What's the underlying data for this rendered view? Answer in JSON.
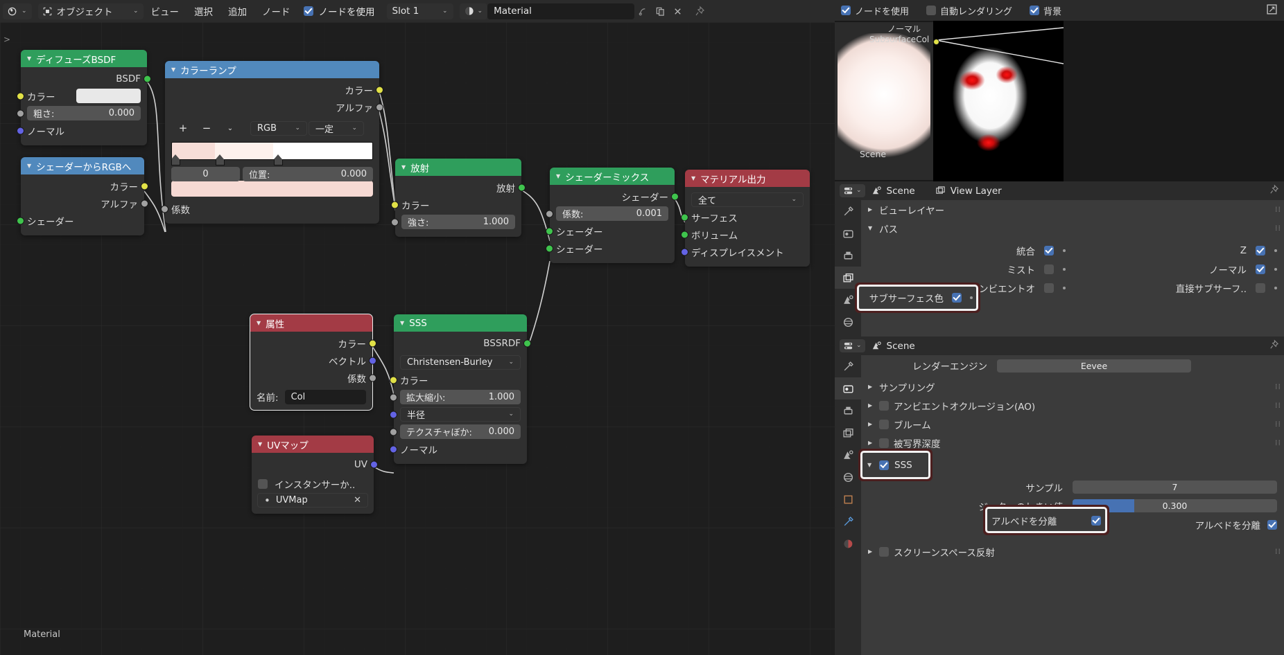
{
  "topbar": {
    "editor_type_icon": "shader-editor-icon",
    "shading_type": "オブジェクト",
    "menus": [
      "ビュー",
      "選択",
      "追加",
      "ノード"
    ],
    "use_nodes_label": "ノードを使用",
    "use_nodes_checked": true,
    "slot": "Slot 1",
    "material_icon": "material-sphere-icon",
    "material_name": "Material",
    "icons": [
      "browse-material-icon",
      "duplicate-icon",
      "unlink-icon",
      "pin-icon"
    ],
    "right_icons": [
      "overlay-icon",
      "snap-icon"
    ]
  },
  "canvas": {
    "footer_label": "Material",
    "sidebar_arrow": ">"
  },
  "nodes": [
    {
      "id": "diffuse-bsdf",
      "title": "ディフューズBSDF",
      "header_color": "#2f9e5c",
      "outputs": [
        {
          "label": "BSDF",
          "color": "green"
        }
      ],
      "inputs": [
        {
          "label": "カラー",
          "color": "yellow",
          "widget": "swatch",
          "value": "#e8e8e8"
        },
        {
          "label": "粗さ:",
          "color": "grey",
          "widget": "field",
          "value": "0.000"
        },
        {
          "label": "ノーマル",
          "color": "purple",
          "widget": "none"
        }
      ]
    },
    {
      "id": "shader-to-rgb",
      "title": "シェーダーからRGBへ",
      "header_color": "#5189bd",
      "outputs": [
        {
          "label": "カラー",
          "color": "yellow"
        },
        {
          "label": "アルファ",
          "color": "grey"
        }
      ],
      "inputs": [
        {
          "label": "シェーダー",
          "color": "green"
        }
      ]
    },
    {
      "id": "color-ramp",
      "title": "カラーランプ",
      "header_color": "#5189bd",
      "outputs": [
        {
          "label": "カラー",
          "color": "yellow"
        },
        {
          "label": "アルファ",
          "color": "grey"
        }
      ],
      "inputs": [
        {
          "label": "係数",
          "color": "grey"
        }
      ],
      "ramp": {
        "buttons": [
          "+",
          "−",
          "⌄"
        ],
        "color_mode": "RGB",
        "interpolation": "一定",
        "index": "0",
        "position_label": "位置:",
        "position_value": "0.000",
        "active_color": "#f6d9d3",
        "stops": [
          {
            "pos": 0.0,
            "color": "#f7ddd7"
          },
          {
            "pos": 0.215,
            "color": "#fdf1ec"
          },
          {
            "pos": 0.505,
            "color": "#ffffff"
          }
        ]
      }
    },
    {
      "id": "emission",
      "title": "放射",
      "header_color": "#2f9e5c",
      "outputs": [
        {
          "label": "放射",
          "color": "green"
        }
      ],
      "inputs": [
        {
          "label": "カラー",
          "color": "yellow",
          "widget": "none"
        },
        {
          "label": "強さ:",
          "color": "grey",
          "widget": "field",
          "value": "1.000"
        }
      ]
    },
    {
      "id": "mix-shader",
      "title": "シェーダーミックス",
      "header_color": "#2f9e5c",
      "outputs": [
        {
          "label": "シェーダー",
          "color": "green"
        }
      ],
      "inputs": [
        {
          "label": "係数:",
          "color": "grey",
          "widget": "field",
          "value": "0.001"
        },
        {
          "label": "シェーダー",
          "color": "green",
          "widget": "none"
        },
        {
          "label": "シェーダー",
          "color": "green",
          "widget": "none"
        }
      ]
    },
    {
      "id": "material-output",
      "title": "マテリアル出力",
      "header_color": "#a33b45",
      "target": "全て",
      "inputs": [
        {
          "label": "サーフェス",
          "color": "green"
        },
        {
          "label": "ボリューム",
          "color": "green"
        },
        {
          "label": "ディスプレイスメント",
          "color": "purple"
        }
      ]
    },
    {
      "id": "attribute",
      "title": "属性",
      "header_color": "#a33b45",
      "selected": true,
      "outputs": [
        {
          "label": "カラー",
          "color": "yellow"
        },
        {
          "label": "ベクトル",
          "color": "purple"
        },
        {
          "label": "係数",
          "color": "grey"
        }
      ],
      "name_label": "名前:",
      "name_value": "Col"
    },
    {
      "id": "sss",
      "title": "SSS",
      "header_color": "#2f9e5c",
      "outputs": [
        {
          "label": "BSSRDF",
          "color": "green"
        }
      ],
      "method": "Christensen-Burley",
      "inputs": [
        {
          "label": "カラー",
          "color": "yellow",
          "widget": "none"
        },
        {
          "label": "拡大縮小:",
          "color": "grey",
          "widget": "field",
          "value": "1.000"
        },
        {
          "label": "半径",
          "color": "purple",
          "widget": "drop",
          "value": "半径"
        },
        {
          "label": "テクスチャぼか:",
          "color": "grey",
          "widget": "field",
          "value": "0.000"
        },
        {
          "label": "ノーマル",
          "color": "purple",
          "widget": "none"
        }
      ]
    },
    {
      "id": "uv-map",
      "title": "UVマップ",
      "header_color": "#a33b45",
      "outputs": [
        {
          "label": "UV",
          "color": "purple"
        }
      ],
      "from_instancer_label": "インスタンサーか..",
      "from_instancer_checked": false,
      "uvmap_value": "UVMap"
    }
  ],
  "preview_header": {
    "use_nodes_label": "ノードを使用",
    "use_nodes_checked": true,
    "auto_render_label": "自動レンダリング",
    "auto_render_checked": false,
    "backdrop_label": "背景",
    "backdrop_checked": true,
    "maximize_icon": "maximize-icon"
  },
  "preview": {
    "socket_labels": [
      "ノーマル",
      "SubsurfaceCol"
    ],
    "scene_label": "Scene"
  },
  "viewlayer_panel": {
    "editor_icon": "properties-editor-icon",
    "scene_name": "Scene",
    "viewlayer_name": "View Layer",
    "pin_icon": "pin-icon",
    "tabs": [
      "tool-icon",
      "render-icon",
      "output-icon",
      "viewlayer-icon",
      "scene-icon",
      "world-icon"
    ],
    "active_tab_index": 3,
    "sections": [
      {
        "label": "ビューレイヤー",
        "open": false
      },
      {
        "label": "パス",
        "open": true
      }
    ],
    "passes": [
      {
        "left_label": "統合",
        "left_checked": true,
        "right_label": "Z",
        "right_checked": true
      },
      {
        "left_label": "ミスト",
        "left_checked": false,
        "right_label": "ノーマル",
        "right_checked": true
      },
      {
        "left_label": "アンビエントオ",
        "left_checked": false,
        "right_label": "直接サブサーフ..",
        "right_checked": false
      },
      {
        "left_label": "サブサーフェス色",
        "left_checked": true,
        "right_label": "",
        "right_checked": false,
        "highlight": true
      }
    ]
  },
  "render_panel": {
    "editor_icon": "properties-editor-icon",
    "scene_name": "Scene",
    "pin_icon": "pin-icon",
    "engine_label": "レンダーエンジン",
    "engine_value": "Eevee",
    "tabs": [
      "tool-icon",
      "render-icon",
      "output-icon",
      "viewlayer-icon",
      "scene-icon",
      "world-icon",
      "object-icon",
      "modifier-icon",
      "material-icon"
    ],
    "active_tab_index": 1,
    "rows": [
      {
        "label": "サンプリング",
        "checkbox": false,
        "open": false
      },
      {
        "label": "アンビエントオクルージョン(AO)",
        "checkbox": true,
        "checked": false,
        "open": false
      },
      {
        "label": "ブルーム",
        "checkbox": true,
        "checked": false,
        "open": false
      },
      {
        "label": "被写界深度",
        "checkbox": true,
        "checked": false,
        "open": false
      },
      {
        "label": "SSS",
        "checkbox": true,
        "checked": true,
        "open": true,
        "highlight": true
      }
    ],
    "sss_samples_label": "サンプル",
    "sss_samples_value": "7",
    "sss_jitter_label": "ジッターのしきい値",
    "sss_jitter_value": "0.300",
    "separate_albedo_label": "アルベドを分離",
    "separate_albedo_checked": true,
    "ssr_label": "スクリーンスペース反射",
    "ssr_checked": false
  }
}
